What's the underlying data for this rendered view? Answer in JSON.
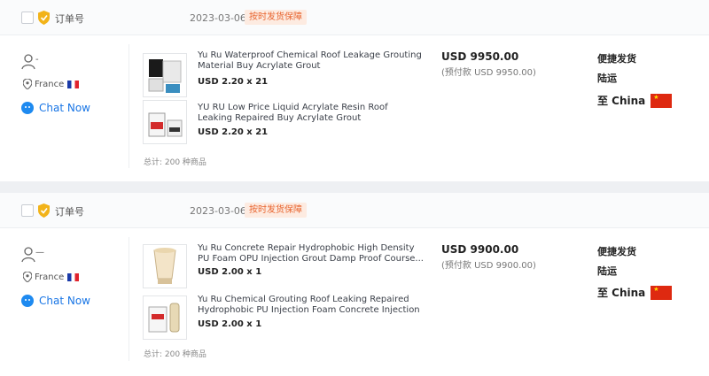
{
  "orders": [
    {
      "header": {
        "order_no_label": "订单号",
        "date": "2023-03-06",
        "badge": "按时发货保障"
      },
      "seller": {
        "name": "-",
        "location": "France",
        "chat_label": "Chat Now"
      },
      "products": [
        {
          "name": "Yu Ru Waterproof Chemical Roof Leakage Grouting Material Buy Acrylate Grout",
          "qty": "USD 2.20 x 21"
        },
        {
          "name": "YU RU Low Price Liquid Acrylate Resin Roof Leaking Repaired Buy Acrylate Grout",
          "qty": "USD 2.20 x 21"
        }
      ],
      "total": "总计: 200 种商品",
      "price": "USD 9950.00",
      "prepay": "(预付款 USD 9950.00)",
      "shipping": {
        "line1": "便捷发货",
        "line2": "陆运",
        "dest": "至 China"
      }
    },
    {
      "header": {
        "order_no_label": "订单号",
        "date": "2023-03-06",
        "badge": "按时发货保障"
      },
      "seller": {
        "name": "—",
        "location": "France",
        "chat_label": "Chat Now"
      },
      "products": [
        {
          "name": "Yu Ru Concrete Repair Hydrophobic High Density PU Foam OPU Injection Grout Damp Proof Course...",
          "qty": "USD 2.00 x 1"
        },
        {
          "name": "Yu Ru Chemical Grouting Roof Leaking Repaired Hydrophobic PU Injection Foam Concrete Injection",
          "qty": "USD 2.00 x 1"
        }
      ],
      "total": "总计: 200 种商品",
      "price": "USD 9900.00",
      "prepay": "(预付款 USD 9900.00)",
      "shipping": {
        "line1": "便捷发货",
        "line2": "陆运",
        "dest": "至 China"
      }
    }
  ],
  "colors": {
    "accent": "#1875e5",
    "badge_text": "#e8642e",
    "badge_bg": "#fdebe1"
  },
  "icons": [
    "checkbox",
    "shield-icon",
    "user-icon",
    "location-pin-icon",
    "france-flag-icon",
    "chat-icon",
    "china-flag-icon"
  ]
}
